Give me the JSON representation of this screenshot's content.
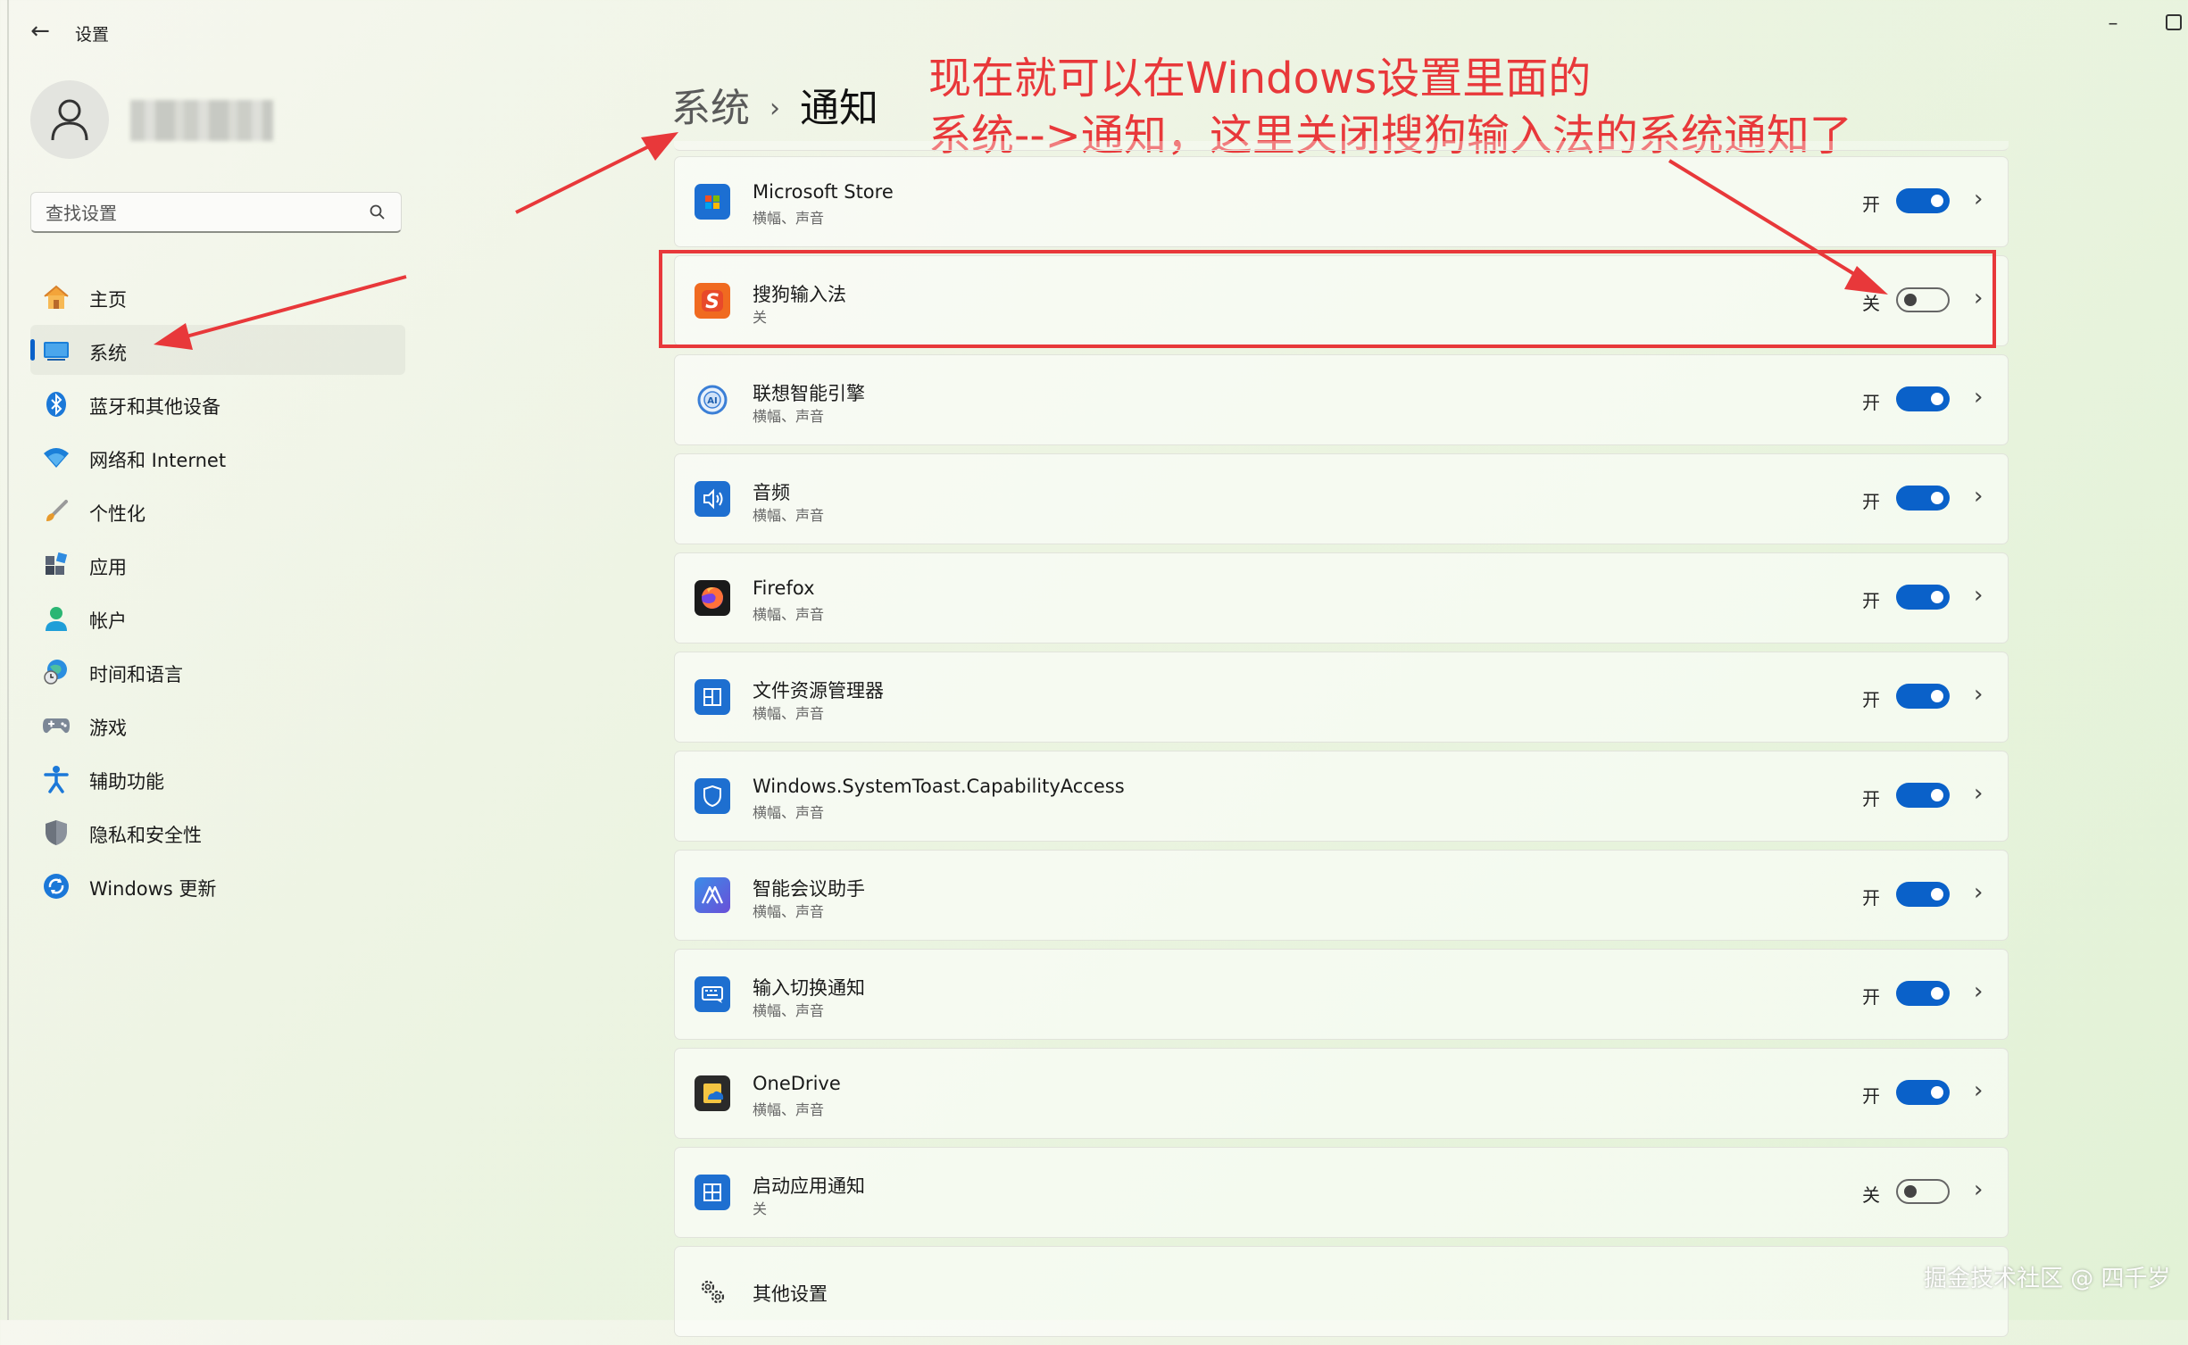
{
  "window": {
    "title": "设置"
  },
  "user": {
    "name_blurred": ""
  },
  "search": {
    "placeholder": "查找设置"
  },
  "sidebar": {
    "items": [
      {
        "label": "主页",
        "icon": "home-icon"
      },
      {
        "label": "系统",
        "icon": "system-icon",
        "selected": true
      },
      {
        "label": "蓝牙和其他设备",
        "icon": "bluetooth-icon"
      },
      {
        "label": "网络和 Internet",
        "icon": "wifi-icon"
      },
      {
        "label": "个性化",
        "icon": "brush-icon"
      },
      {
        "label": "应用",
        "icon": "apps-icon"
      },
      {
        "label": "帐户",
        "icon": "account-icon"
      },
      {
        "label": "时间和语言",
        "icon": "globe-clock-icon"
      },
      {
        "label": "游戏",
        "icon": "gamepad-icon"
      },
      {
        "label": "辅助功能",
        "icon": "accessibility-icon"
      },
      {
        "label": "隐私和安全性",
        "icon": "shield-icon"
      },
      {
        "label": "Windows 更新",
        "icon": "update-icon"
      }
    ]
  },
  "breadcrumb": {
    "parent": "系统",
    "separator": "›",
    "current": "通知"
  },
  "annotation": {
    "line1": "现在就可以在Windows设置里面的",
    "line2": "系统-->通知，这里关闭搜狗输入法的系统通知了"
  },
  "state_labels": {
    "on": "开",
    "off": "关"
  },
  "apps": [
    {
      "name": "Microsoft Store",
      "sub": "横幅、声音",
      "on": true,
      "icon": "store-icon"
    },
    {
      "name": "搜狗输入法",
      "sub": "关",
      "on": false,
      "icon": "sogou-icon",
      "highlighted": true
    },
    {
      "name": "联想智能引擎",
      "sub": "横幅、声音",
      "on": true,
      "icon": "ai-engine-icon"
    },
    {
      "name": "音频",
      "sub": "横幅、声音",
      "on": true,
      "icon": "speaker-icon"
    },
    {
      "name": "Firefox",
      "sub": "横幅、声音",
      "on": true,
      "icon": "firefox-icon"
    },
    {
      "name": "文件资源管理器",
      "sub": "横幅、声音",
      "on": true,
      "icon": "explorer-icon"
    },
    {
      "name": "Windows.SystemToast.CapabilityAccess",
      "sub": "横幅、声音",
      "on": true,
      "icon": "capability-shield-icon"
    },
    {
      "name": "智能会议助手",
      "sub": "横幅、声音",
      "on": true,
      "icon": "meeting-assistant-icon"
    },
    {
      "name": "输入切换通知",
      "sub": "横幅、声音",
      "on": true,
      "icon": "keyboard-icon"
    },
    {
      "name": "OneDrive",
      "sub": "横幅、声音",
      "on": true,
      "icon": "onedrive-icon"
    },
    {
      "name": "启动应用通知",
      "sub": "关",
      "on": false,
      "icon": "startup-apps-icon"
    },
    {
      "name": "其他设置",
      "sub": "",
      "on": null,
      "icon": "gear-icon"
    }
  ],
  "watermark": "掘金技术社区 @ 四千岁",
  "colors": {
    "accent": "#0a61c9",
    "annotation": "#e8383a"
  }
}
